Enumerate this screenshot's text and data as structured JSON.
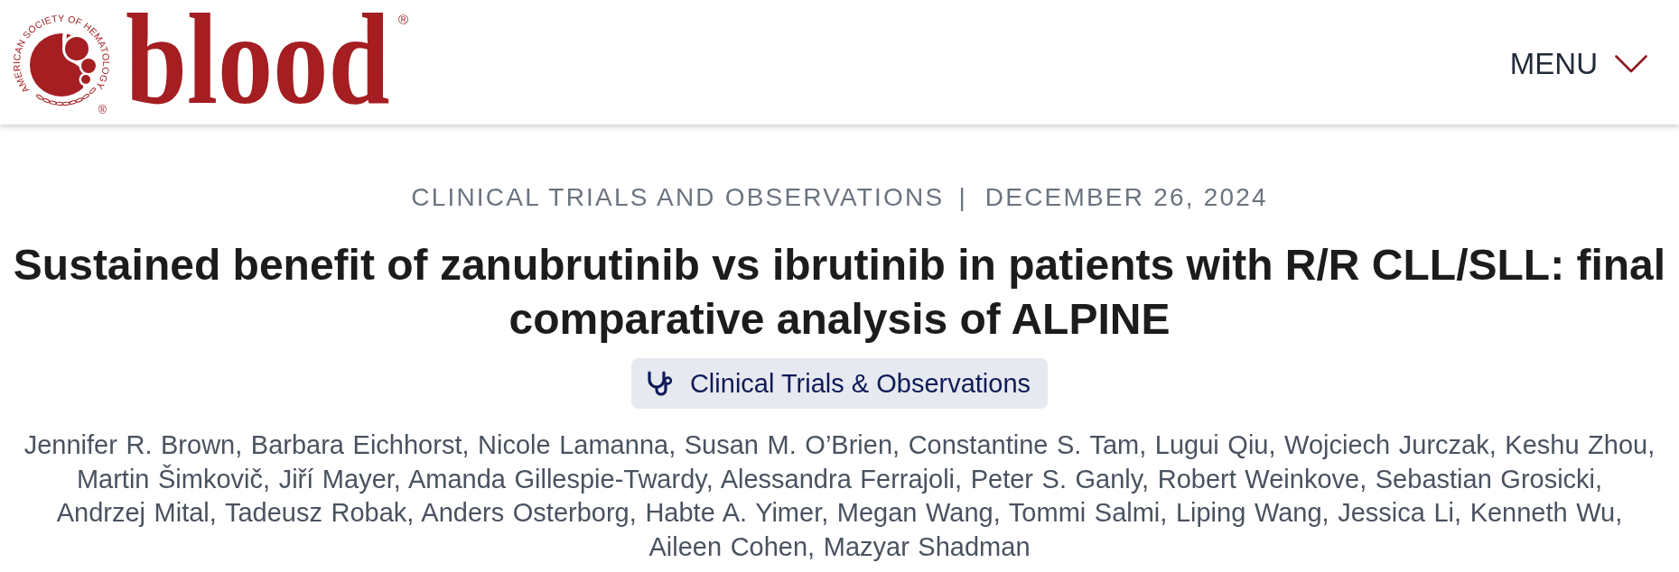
{
  "header": {
    "logo": {
      "ring_text": "AMERICAN SOCIETY OF HEMATOLOGY",
      "ring_mark": "®",
      "wordmark": "blood",
      "wordmark_mark": "®"
    },
    "menu": {
      "label": "MENU",
      "expanded": false
    }
  },
  "article": {
    "category": "CLINICAL TRIALS AND OBSERVATIONS",
    "separator": "|",
    "date": "DECEMBER 26, 2024",
    "title": "Sustained benefit of zanubrutinib vs ibrutinib in patients with R/R CLL/SLL: final comparative analysis of ALPINE",
    "topic_tag": "Clinical Trials & Observations",
    "authors": [
      "Jennifer R. Brown,",
      "Barbara Eichhorst,",
      "Nicole Lamanna,",
      "Susan M. O’Brien,",
      "Constantine S. Tam,",
      "Lugui Qiu,",
      "Wojciech Jurczak,",
      "Keshu Zhou,",
      "Martin Šimkovič,",
      "Jiří Mayer,",
      "Amanda Gillespie-Twardy,",
      "Alessandra Ferrajoli,",
      "Peter S. Ganly,",
      "Robert Weinkove,",
      "Sebastian Grosicki,",
      "Andrzej Mital,",
      "Tadeusz Robak,",
      "Anders Osterborg,",
      "Habte A. Yimer,",
      "Megan Wang,",
      "Tommi Salmi,",
      "Liping Wang,",
      "Jessica Li,",
      "Kenneth Wu,",
      "Aileen Cohen,",
      "Mazyar Shadman"
    ]
  }
}
